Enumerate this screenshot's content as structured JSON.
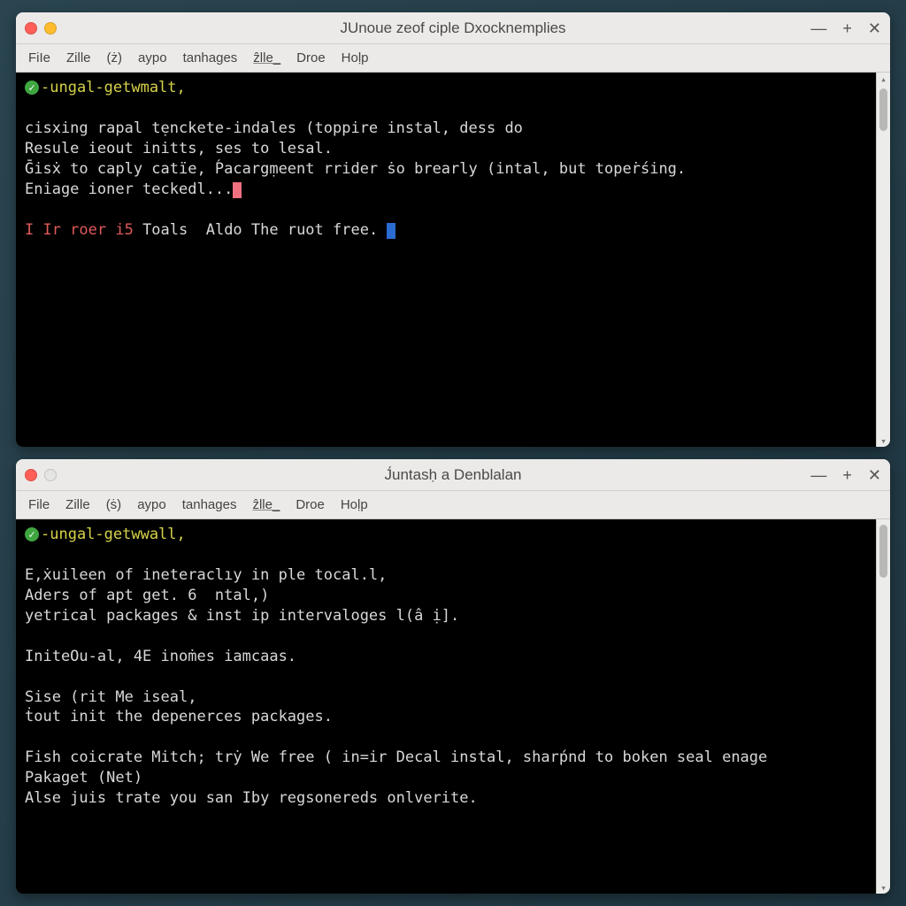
{
  "windows": [
    {
      "title": "JUnoue zeof ciple Dxocknemplies",
      "traffic": [
        "close",
        "min"
      ],
      "menubar": [
        "FiIe",
        "Zille",
        "(ż)",
        "aypo",
        "tanhages",
        "ẑlle_",
        "Droe",
        "Hoḷp"
      ],
      "prompt": "-ungal-getwmalt,",
      "lines": [
        {
          "text": ""
        },
        {
          "text": "cisxing rapal tẹnckete-indales (toppire instal, dess do"
        },
        {
          "text": "Resule ieout initts, ses to lesal."
        },
        {
          "text": "Ḡisẋ to caply catïe, Ṕacargṃeent rrider ṡo brearly (intal, but topeṙśing."
        },
        {
          "text": "Eniage ioner teckedl...",
          "cursor": "pink"
        },
        {
          "text": ""
        },
        {
          "prefix_red": "I Ir roer i5 ",
          "prefix2": "Toals  ",
          "text": "Aldo The ruot free. ",
          "cursor": "blue"
        }
      ]
    },
    {
      "title": "J́untasḥ a Denblalan",
      "traffic": [
        "close",
        "empty"
      ],
      "menubar": [
        "File",
        "Zille",
        "(ṡ)",
        "aypo",
        "tanhages",
        "ẑlle_",
        "Droe",
        "Hoḷp"
      ],
      "prompt": "-ungal-getwwall,",
      "lines": [
        {
          "text": ""
        },
        {
          "text": "E,ẋuileen of ineteraclıy in ple tocal.l,"
        },
        {
          "text": "Aders of apt get. 6  ntal,)"
        },
        {
          "text": "yetrical packages & inst ip intervaloges l(â ị]."
        },
        {
          "text": ""
        },
        {
          "text": "IniteOu-al, 4E inoṁes iamcaas."
        },
        {
          "text": ""
        },
        {
          "text": "Sise (rit Me iseal,"
        },
        {
          "text": "ṫout init the depenerces packages."
        },
        {
          "text": ""
        },
        {
          "text": "Fish coicrate Mitch; trẏ We free ( in=ir Decal instal, sharṕnd to boken seal enage"
        },
        {
          "text": "Pakaget (Net)"
        },
        {
          "text": "Alse juis trate you san Iby regsonereds onlverite."
        }
      ]
    }
  ],
  "winctrl": {
    "min": "—",
    "plus": "+",
    "close": "✕"
  },
  "check": "✓"
}
